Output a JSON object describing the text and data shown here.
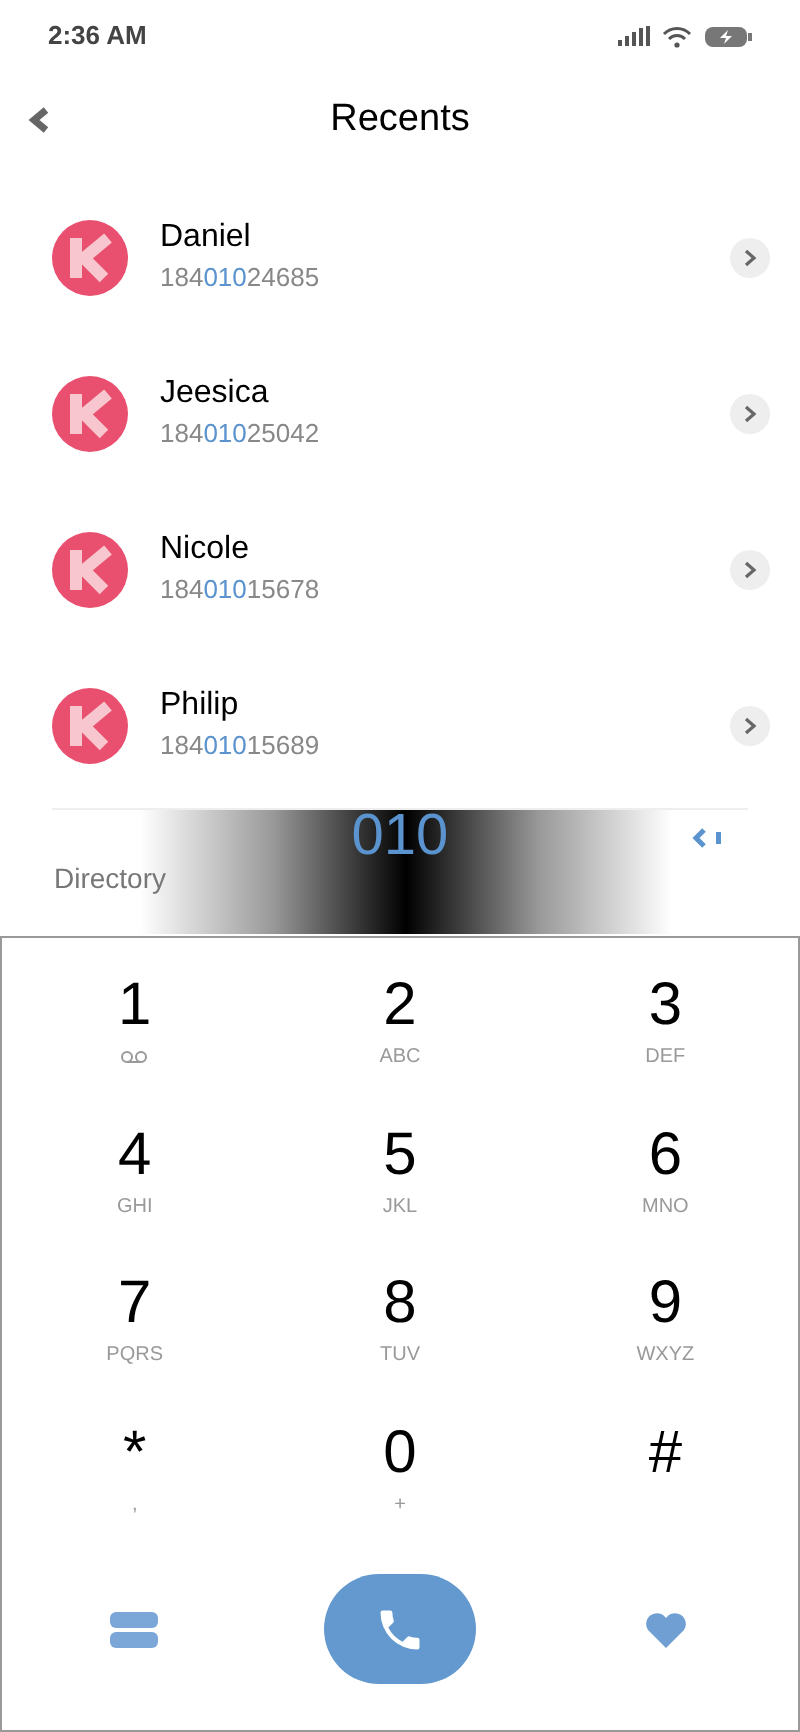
{
  "status_bar": {
    "time": "2:36 AM"
  },
  "header": {
    "title": "Recents"
  },
  "contacts": [
    {
      "name": "Daniel",
      "number_prefix": "184",
      "number_match": "010",
      "number_suffix": "24685"
    },
    {
      "name": "Jeesica",
      "number_prefix": "184",
      "number_match": "010",
      "number_suffix": "25042"
    },
    {
      "name": "Nicole",
      "number_prefix": "184",
      "number_match": "010",
      "number_suffix": "15678"
    },
    {
      "name": "Philip",
      "number_prefix": "184",
      "number_match": "010",
      "number_suffix": "15689"
    }
  ],
  "dial_display": {
    "label": "Directory",
    "number": "010"
  },
  "keypad": [
    {
      "digit": "1",
      "kind": "voicemail"
    },
    {
      "digit": "2",
      "letters": "ABC",
      "kind": "letters"
    },
    {
      "digit": "3",
      "letters": "DEF",
      "kind": "letters"
    },
    {
      "digit": "4",
      "letters": "GHI",
      "kind": "letters"
    },
    {
      "digit": "5",
      "letters": "JKL",
      "kind": "letters"
    },
    {
      "digit": "6",
      "letters": "MNO",
      "kind": "letters"
    },
    {
      "digit": "7",
      "letters": "PQRS",
      "kind": "letters"
    },
    {
      "digit": "8",
      "letters": "TUV",
      "kind": "letters"
    },
    {
      "digit": "9",
      "letters": "WXYZ",
      "kind": "letters"
    },
    {
      "digit": "*",
      "letters": ",",
      "kind": "letters"
    },
    {
      "digit": "0",
      "letters": "+",
      "kind": "letters"
    },
    {
      "digit": "#",
      "kind": "none"
    }
  ]
}
